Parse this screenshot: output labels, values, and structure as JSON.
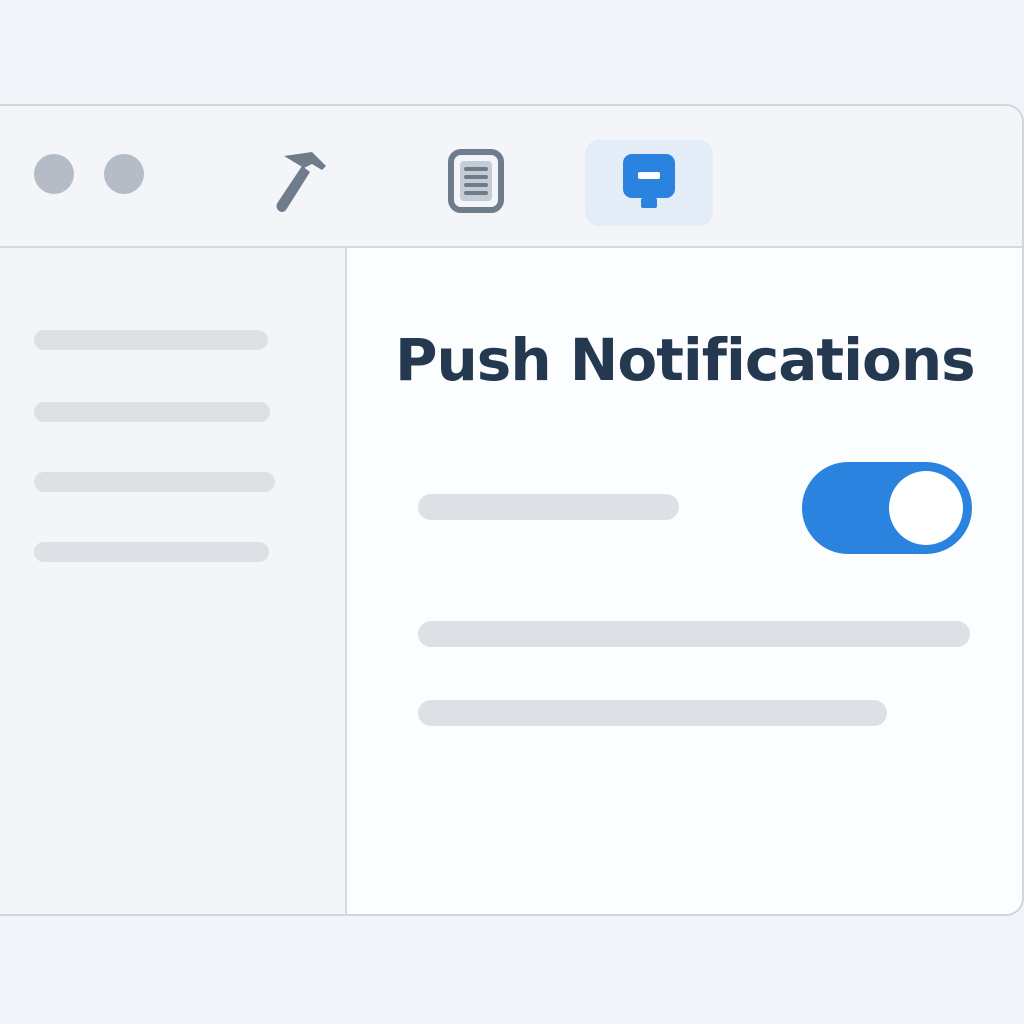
{
  "window": {
    "toolbar": {
      "tools": [
        {
          "icon": "hammer-icon",
          "active": false
        },
        {
          "icon": "document-icon",
          "active": false
        },
        {
          "icon": "notification-icon",
          "active": true
        }
      ]
    }
  },
  "main": {
    "title": "Push Notifications",
    "toggle": {
      "on": true
    }
  },
  "colors": {
    "accent": "#2a84df",
    "title": "#243850",
    "placeholder": "#dde1e6"
  }
}
